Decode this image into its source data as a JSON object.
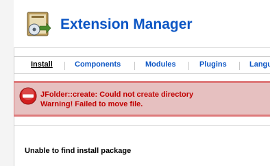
{
  "header": {
    "title": "Extension Manager",
    "icon": "install-package-icon"
  },
  "tabs": [
    {
      "label": "Install",
      "active": true
    },
    {
      "label": "Components",
      "active": false
    },
    {
      "label": "Modules",
      "active": false
    },
    {
      "label": "Plugins",
      "active": false
    },
    {
      "label": "Langu",
      "active": false
    }
  ],
  "error": {
    "icon": "error-stop-icon",
    "line1": "JFolder::create: Could not create directory",
    "line2": "Warning! Failed to move file."
  },
  "panel": {
    "message": "Unable to find install package"
  },
  "colors": {
    "title_blue": "#0b55c4",
    "error_bg": "#e6c0c0",
    "error_border": "#de7a7b",
    "error_text": "#c00000"
  }
}
